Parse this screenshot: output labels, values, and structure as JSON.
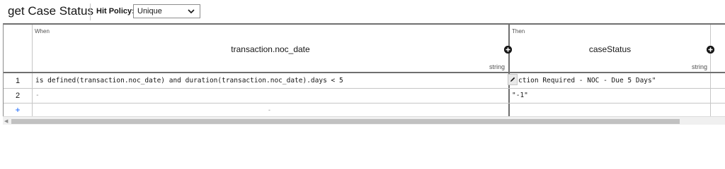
{
  "header": {
    "title": "get Case Status",
    "hit_policy_label": "Hit Policy:",
    "hit_policy_value": "Unique"
  },
  "table": {
    "input_section_label": "When",
    "output_section_label": "Then",
    "input_column": {
      "name": "transaction.noc_date",
      "type": "string"
    },
    "output_column": {
      "name": "caseStatus",
      "type": "string"
    },
    "rows": [
      {
        "number": "1",
        "input": "is defined(transaction.noc_date) and duration(transaction.noc_date).days < 5",
        "output": "ction Required - NOC - Due 5 Days\""
      },
      {
        "number": "2",
        "input": "-",
        "output": "\"-1\""
      }
    ],
    "add_row_symbol": "+",
    "placeholder_dash": "-"
  },
  "icons": {
    "add_column": "plus-circle-icon",
    "edit": "pencil-icon",
    "dropdown": "chevron-down-icon",
    "scroll_left": "scroll-left-icon"
  }
}
